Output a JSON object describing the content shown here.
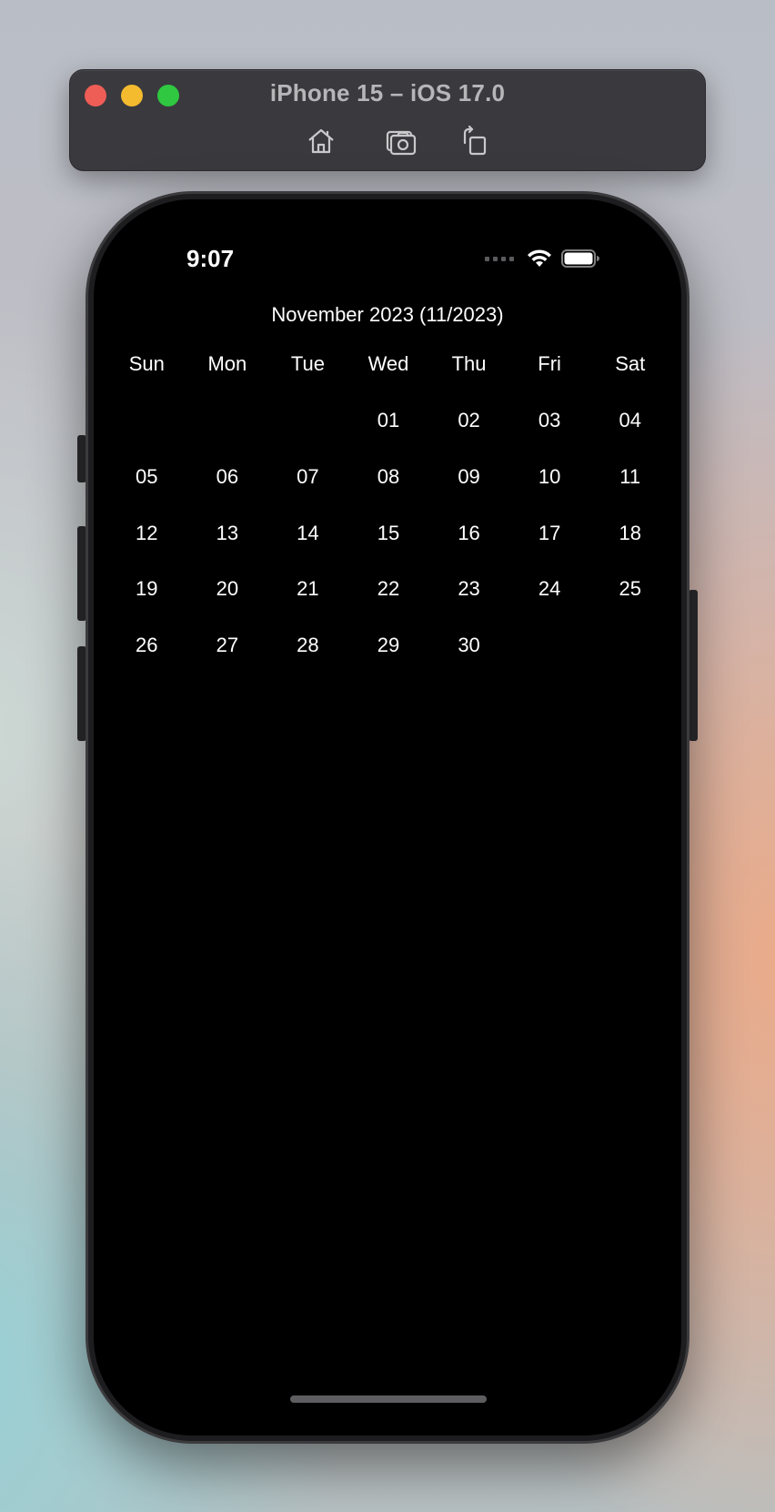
{
  "simulator": {
    "title": "iPhone 15 – iOS 17.0",
    "buttons": [
      {
        "name": "home",
        "icon": "house-icon"
      },
      {
        "name": "screenshot",
        "icon": "camera-icon"
      },
      {
        "name": "rotate",
        "icon": "rotate-icon"
      }
    ],
    "traffic_colors": {
      "close": "#ee5d56",
      "minimize": "#f4bb2f",
      "maximize": "#2fc840"
    }
  },
  "status_bar": {
    "time": "9:07",
    "icons": [
      "cellular-signal-icon",
      "wifi-icon",
      "battery-icon"
    ]
  },
  "calendar": {
    "title": "November 2023 (11/2023)",
    "weekdays": [
      "Sun",
      "Mon",
      "Tue",
      "Wed",
      "Thu",
      "Fri",
      "Sat"
    ],
    "weeks": [
      [
        "",
        "",
        "",
        "01",
        "02",
        "03",
        "04"
      ],
      [
        "05",
        "06",
        "07",
        "08",
        "09",
        "10",
        "11"
      ],
      [
        "12",
        "13",
        "14",
        "15",
        "16",
        "17",
        "18"
      ],
      [
        "19",
        "20",
        "21",
        "22",
        "23",
        "24",
        "25"
      ],
      [
        "26",
        "27",
        "28",
        "29",
        "30",
        "",
        ""
      ]
    ]
  },
  "colors": {
    "screen_background": "#000000",
    "text": "#ffffff",
    "sim_bar": "#3a393e"
  }
}
